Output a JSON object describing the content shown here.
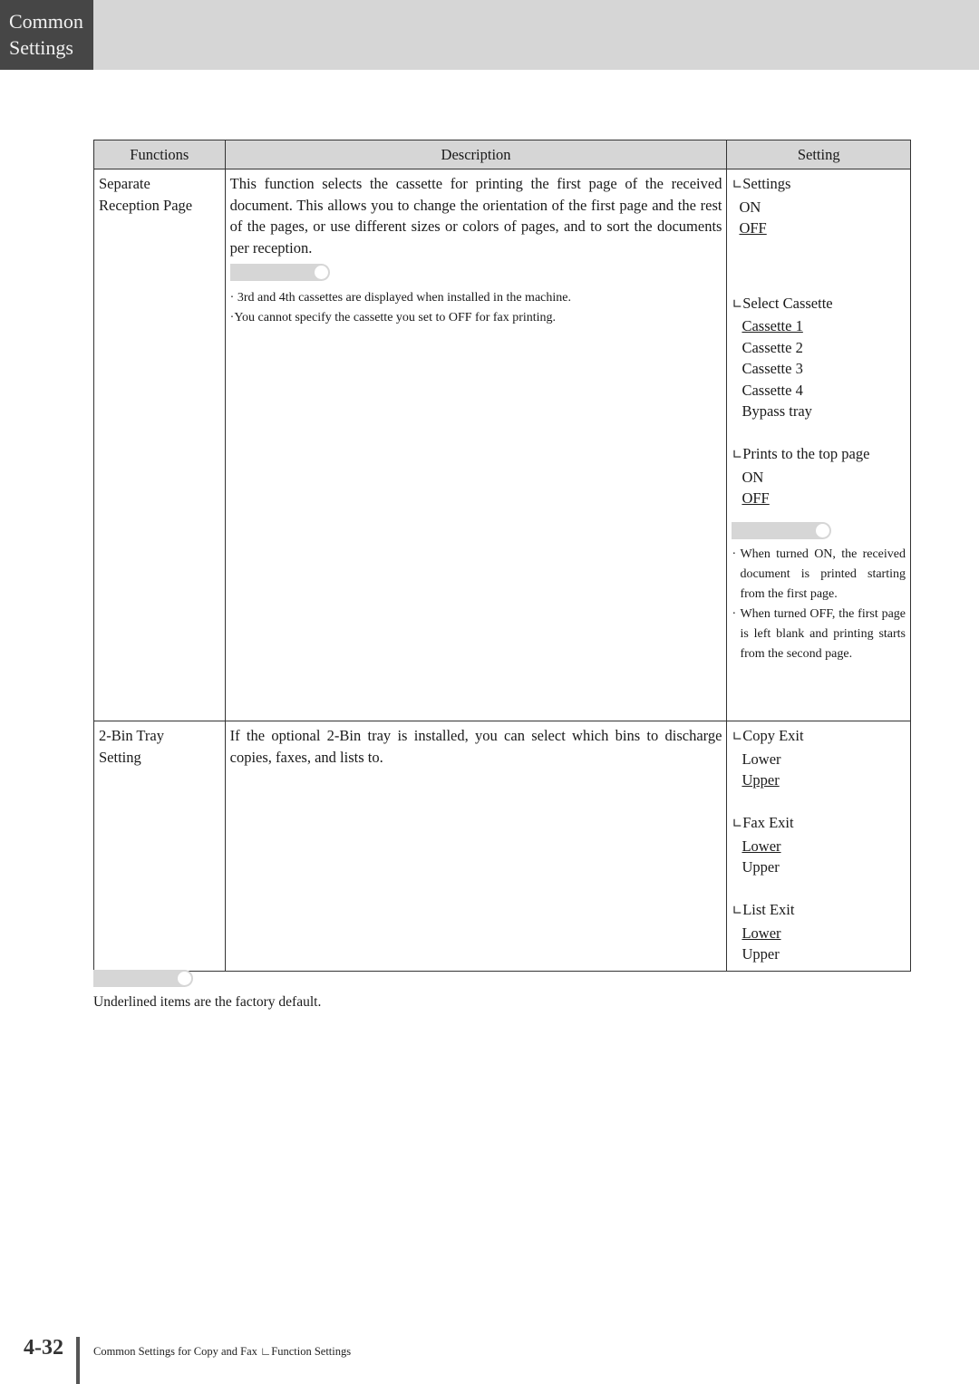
{
  "header": {
    "section_tab": [
      "Common",
      "Settings"
    ]
  },
  "table": {
    "columns": [
      "Functions",
      "Description",
      "Setting"
    ],
    "rows": [
      {
        "function": [
          "Separate",
          "Reception Page"
        ],
        "description": "This function selects the cassette for printing the first page of the received document. This allows you to change the orientation of the first page and the rest of the pages, or use different sizes or colors of pages, and to sort the documents per reception.",
        "description_notes": [
          "3rd and 4th cassettes are displayed when installed in the machine.",
          "You cannot specify the cassette you set to OFF for fax printing."
        ],
        "settings": [
          {
            "label": "Settings",
            "options": [
              {
                "text": "ON",
                "default": false
              },
              {
                "text": "OFF",
                "default": true
              }
            ]
          },
          {
            "label": "Select Cassette",
            "options": [
              {
                "text": "Cassette 1",
                "default": true
              },
              {
                "text": "Cassette 2",
                "default": false
              },
              {
                "text": "Cassette 3",
                "default": false
              },
              {
                "text": "Cassette 4",
                "default": false
              },
              {
                "text": "Bypass tray",
                "default": false
              }
            ]
          },
          {
            "label": "Prints to the top page",
            "options": [
              {
                "text": "ON",
                "default": false
              },
              {
                "text": "OFF",
                "default": true
              }
            ]
          }
        ],
        "setting_notes": [
          "When turned ON, the received document is printed starting from the first page.",
          "When turned OFF, the first page is left blank and printing starts from the second page."
        ]
      },
      {
        "function": [
          "2-Bin Tray",
          "Setting"
        ],
        "description": "If the optional 2-Bin tray is installed, you can select which bins to discharge copies, faxes, and lists to.",
        "settings": [
          {
            "label": "Copy Exit",
            "options": [
              {
                "text": "Lower",
                "default": false
              },
              {
                "text": "Upper",
                "default": true
              }
            ]
          },
          {
            "label": "Fax Exit",
            "options": [
              {
                "text": "Lower",
                "default": true
              },
              {
                "text": "Upper",
                "default": false
              }
            ]
          },
          {
            "label": "List Exit",
            "options": [
              {
                "text": "Lower",
                "default": true
              },
              {
                "text": "Upper",
                "default": false
              }
            ]
          }
        ]
      }
    ]
  },
  "tree_glyph": "∟",
  "bullet": "·",
  "footnote": "Underlined items are the factory default.",
  "footer": {
    "page_number": "4-32",
    "breadcrumb": "Common Settings for Copy and Fax ∟Function Settings"
  }
}
